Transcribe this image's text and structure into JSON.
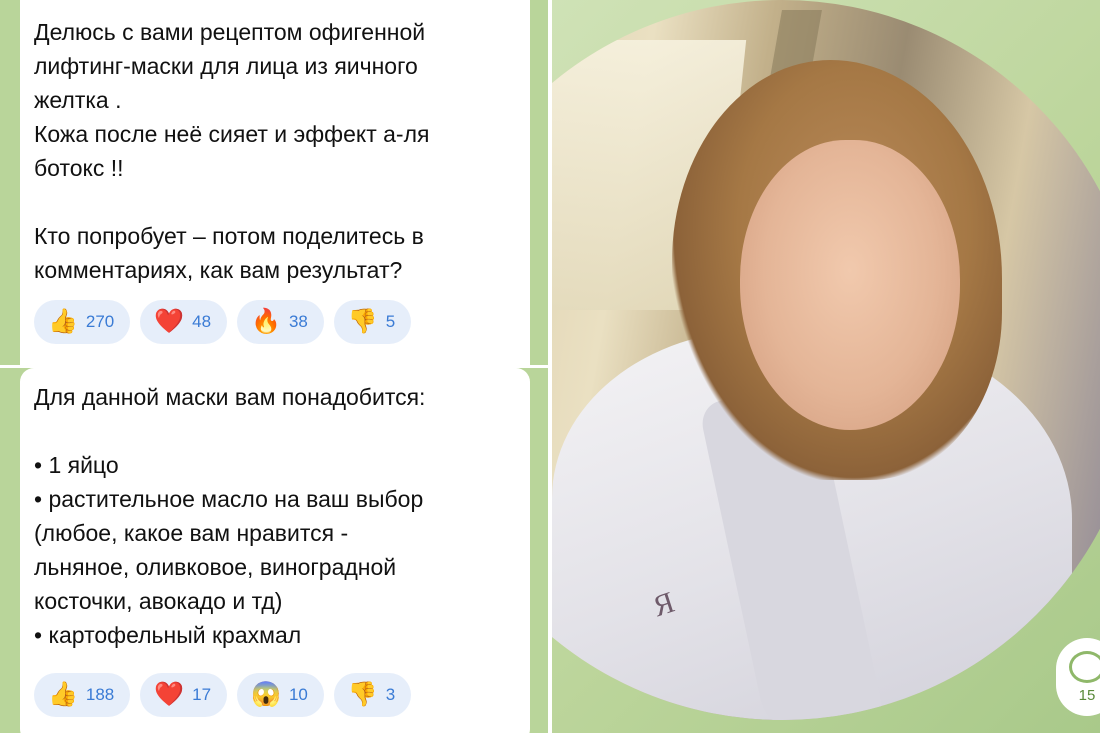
{
  "post1": {
    "text": "Делюсь с вами рецептом офигенной\nлифтинг-маски для лица из яичного\nжелтка .\nКожа после неё сияет и эффект а-ля\nботокс !!\n\nКто попробует – потом поделитесь в\nкомментариях, как вам результат?",
    "reactions": [
      {
        "icon": "thumbs-up-icon",
        "emoji": "👍",
        "count": "270"
      },
      {
        "icon": "heart-icon",
        "emoji": "❤️",
        "count": "48"
      },
      {
        "icon": "fire-icon",
        "emoji": "🔥",
        "count": "38"
      },
      {
        "icon": "thumbs-down-icon",
        "emoji": "👎",
        "count": "5"
      }
    ]
  },
  "post2": {
    "text": "Для данной маски вам понадобится:\n\n• 1 яйцо\n• растительное масло на ваш выбор\n(любое, какое вам нравится -\nльняное, оливковое, виноградной\nкосточки, авокадо и тд)\n• картофельный крахмал",
    "reactions": [
      {
        "icon": "thumbs-up-icon",
        "emoji": "👍",
        "count": "188"
      },
      {
        "icon": "heart-icon",
        "emoji": "❤️",
        "count": "17"
      },
      {
        "icon": "scream-face-icon",
        "emoji": "😱",
        "count": "10"
      },
      {
        "icon": "thumbs-down-icon",
        "emoji": "👎",
        "count": "3"
      }
    ]
  },
  "video_message": {
    "monogram": "Я",
    "comments_count": "15"
  },
  "colors": {
    "chat_background": "#b9d59a",
    "reaction_pill": "#e6eefa",
    "reaction_count": "#3a7bd5"
  }
}
